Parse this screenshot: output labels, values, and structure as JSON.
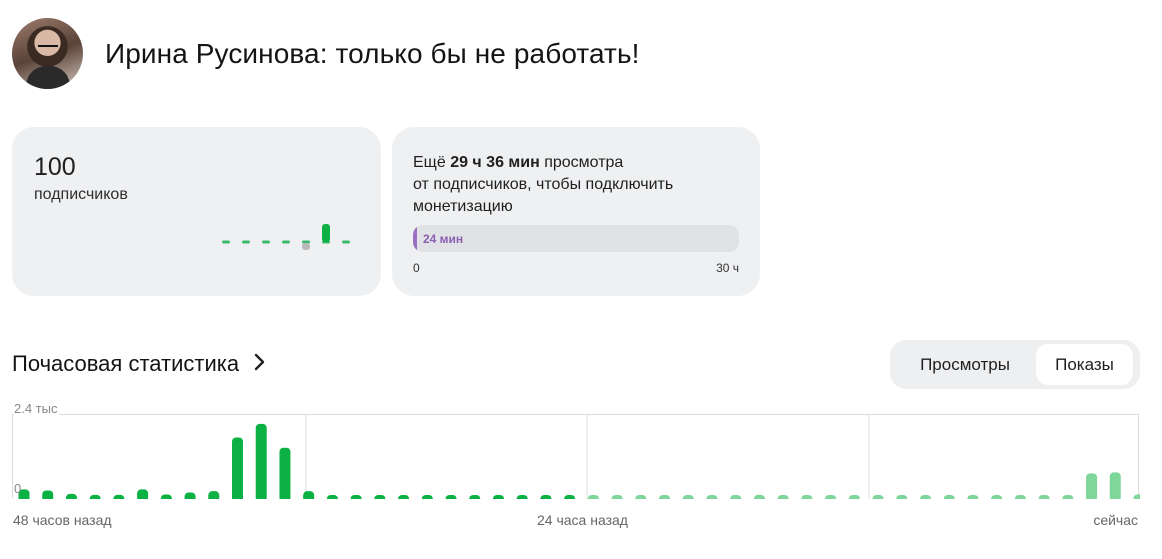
{
  "header": {
    "title": "Ирина Русинова: только бы не работать!",
    "avatar_icon": "user-photo"
  },
  "subscribers": {
    "count": "100",
    "label": "подписчиков",
    "sparkline": [
      0,
      0,
      0,
      0,
      -1,
      4,
      0
    ]
  },
  "monetization": {
    "text_before": "Ещё ",
    "time_left": "29 ч 36 мин",
    "text_after": " просмотра",
    "line2": "от подписчиков, чтобы подключить",
    "line3": "монетизацию",
    "progress_label": "24 мин",
    "progress_fraction": 0.0133,
    "scale_min": "0",
    "scale_max": "30 ч",
    "accent": "#9a6ec0"
  },
  "hourly": {
    "title": "Почасовая статистика",
    "chevron_icon": "chevron-right-icon"
  },
  "toggle": {
    "option_views": "Просмотры",
    "option_impressions": "Показы",
    "selected": "Показы"
  },
  "chart_data": {
    "type": "bar",
    "ylabel_top": "2.4 тыс",
    "ylabel_zero": "0",
    "ylim": [
      0,
      2400
    ],
    "x_labels": [
      "48 часов назад",
      "24 часа назад",
      "сейчас"
    ],
    "colors": {
      "past": "#0bb243",
      "recent": "#7fd69b"
    },
    "values_past_24h": [
      280,
      250,
      150,
      120,
      120,
      280,
      130,
      190,
      230,
      1800,
      2200,
      1500,
      230,
      110,
      110,
      110,
      110,
      110,
      110,
      110,
      110,
      110,
      110,
      110
    ],
    "values_last_24h": [
      110,
      110,
      110,
      110,
      110,
      110,
      110,
      120,
      110,
      110,
      110,
      110,
      110,
      110,
      110,
      110,
      110,
      110,
      110,
      110,
      110,
      750,
      780,
      130
    ]
  }
}
